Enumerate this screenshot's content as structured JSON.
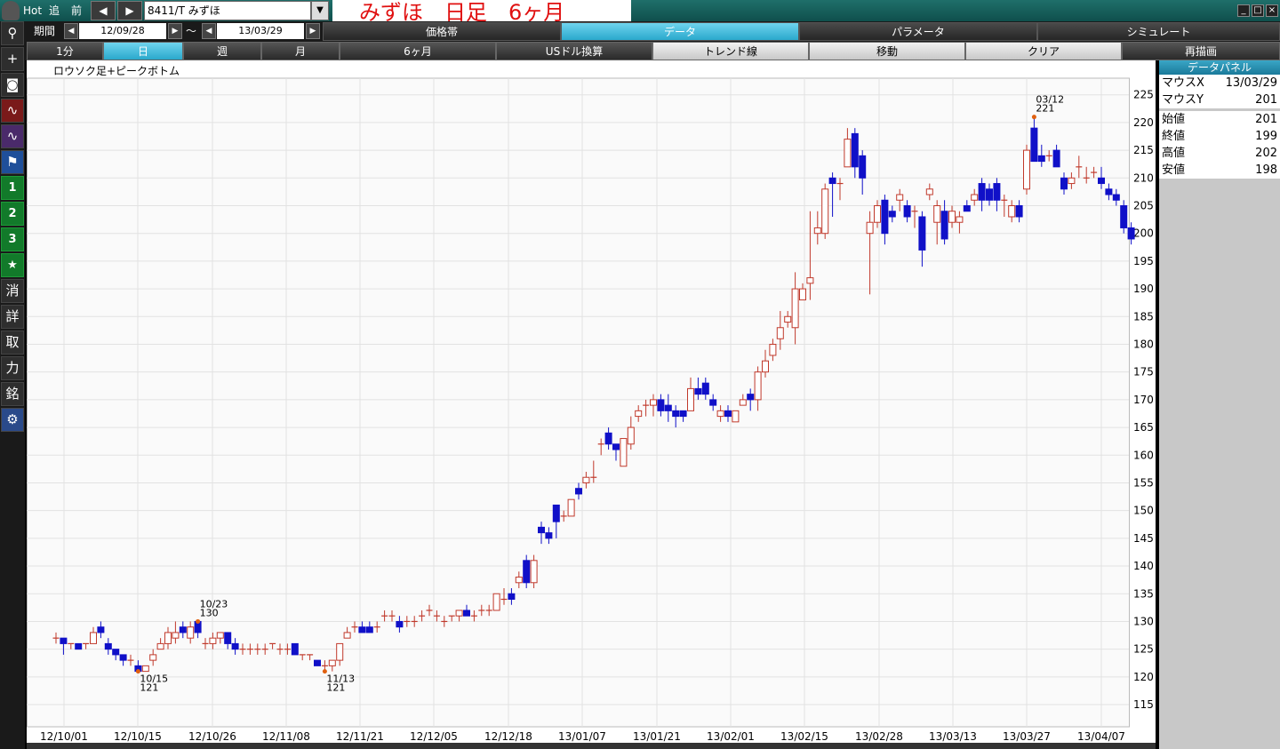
{
  "title_bar": {
    "hot": "Hot",
    "add": "追",
    "prev": "前",
    "arrow_left": "◀",
    "arrow_right": "▶",
    "symbol": "8411/T みずほ",
    "dropdown": "▼",
    "chart_title": "みずほ　日足　6ヶ月",
    "win_minimize": "_",
    "win_maximize": "□",
    "win_close": "×"
  },
  "period": {
    "label": "期間",
    "from": "12/09/28",
    "tilde": "～",
    "to": "13/03/29"
  },
  "top_tabs": [
    {
      "label": "価格帯",
      "active": false
    },
    {
      "label": "データ",
      "active": true
    },
    {
      "label": "パラメータ",
      "active": false
    },
    {
      "label": "シミュレート",
      "active": false
    }
  ],
  "row3_tabs": [
    {
      "label": "1分",
      "style": "normal"
    },
    {
      "label": "日",
      "style": "active"
    },
    {
      "label": "週",
      "style": "normal"
    },
    {
      "label": "月",
      "style": "normal"
    },
    {
      "label": "6ヶ月",
      "style": "normal"
    },
    {
      "label": "USドル換算",
      "style": "normal"
    },
    {
      "label": "トレンド線",
      "style": "light"
    },
    {
      "label": "移動",
      "style": "light"
    },
    {
      "label": "クリア",
      "style": "light"
    },
    {
      "label": "再描画",
      "style": "normal"
    }
  ],
  "left_toolbar": [
    {
      "name": "search-icon",
      "glyph": "⚲",
      "style": ""
    },
    {
      "name": "crosshair-icon",
      "glyph": "+",
      "style": ""
    },
    {
      "name": "camera-icon",
      "glyph": "◙",
      "style": ""
    },
    {
      "name": "chart-red-icon",
      "glyph": "∿",
      "style": "red"
    },
    {
      "name": "chart-purple-icon",
      "glyph": "∿",
      "style": "purple"
    },
    {
      "name": "flag-icon",
      "glyph": "⚑",
      "style": "blue"
    },
    {
      "name": "preset-1-icon",
      "glyph": "1",
      "style": "green"
    },
    {
      "name": "preset-2-icon",
      "glyph": "2",
      "style": "green"
    },
    {
      "name": "preset-3-icon",
      "glyph": "3",
      "style": "green"
    },
    {
      "name": "star-icon",
      "glyph": "★",
      "style": "green"
    },
    {
      "name": "erase-icon",
      "glyph": "消",
      "style": ""
    },
    {
      "name": "detail-icon",
      "glyph": "詳",
      "style": ""
    },
    {
      "name": "take-icon",
      "glyph": "取",
      "style": ""
    },
    {
      "name": "power-icon",
      "glyph": "力",
      "style": ""
    },
    {
      "name": "brand-icon",
      "glyph": "銘",
      "style": ""
    },
    {
      "name": "gear-icon",
      "glyph": "⚙",
      "style": "gear"
    }
  ],
  "data_panel": {
    "title": "データパネル",
    "mouse_x_label": "マウスX",
    "mouse_x": "13/03/29",
    "mouse_y_label": "マウスY",
    "mouse_y": "201",
    "open_label": "始値",
    "open": "201",
    "close_label": "終値",
    "close": "199",
    "high_label": "高値",
    "high": "202",
    "low_label": "安値",
    "low": "198"
  },
  "chart_data": {
    "type": "candlestick",
    "title": "ロウソク足+ピークボトム",
    "ylim": [
      111,
      228
    ],
    "yticks": [
      115,
      120,
      125,
      130,
      135,
      140,
      145,
      150,
      155,
      160,
      165,
      170,
      175,
      180,
      185,
      190,
      195,
      200,
      205,
      210,
      215,
      220,
      225
    ],
    "xticks": [
      "12/10/01",
      "12/10/15",
      "12/10/26",
      "12/11/08",
      "12/11/21",
      "12/12/05",
      "12/12/18",
      "13/01/07",
      "13/01/21",
      "13/02/01",
      "13/02/15",
      "13/02/28",
      "13/03/13",
      "13/03/27",
      "13/04/07"
    ],
    "up_color": "#c0392b",
    "down_color": "#1010c8",
    "candles": [
      [
        127,
        128,
        126,
        127
      ],
      [
        127,
        127,
        124,
        126
      ],
      [
        126,
        126,
        125,
        126
      ],
      [
        126,
        126,
        125,
        125
      ],
      [
        126,
        126,
        125,
        126
      ],
      [
        126,
        129,
        126,
        128
      ],
      [
        129,
        130,
        127,
        128
      ],
      [
        126,
        127,
        124,
        125
      ],
      [
        125,
        125,
        123,
        124
      ],
      [
        124,
        124,
        122,
        123
      ],
      [
        123,
        124,
        122,
        123
      ],
      [
        122,
        123,
        121,
        121
      ],
      [
        121,
        122,
        121,
        122
      ],
      [
        123,
        125,
        122,
        124
      ],
      [
        125,
        127,
        125,
        126
      ],
      [
        126,
        129,
        125,
        128
      ],
      [
        127,
        130,
        126,
        128
      ],
      [
        129,
        130,
        127,
        128
      ],
      [
        127,
        130,
        126,
        129
      ],
      [
        130,
        130,
        127,
        128
      ],
      [
        126,
        127,
        125,
        126
      ],
      [
        126,
        128,
        125,
        127
      ],
      [
        127,
        128,
        126,
        128
      ],
      [
        128,
        128,
        125,
        126
      ],
      [
        126,
        127,
        124,
        125
      ],
      [
        125,
        126,
        124,
        125
      ],
      [
        125,
        126,
        124,
        125
      ],
      [
        125,
        126,
        124,
        125
      ],
      [
        125,
        126,
        124,
        125
      ],
      [
        126,
        126,
        125,
        126
      ],
      [
        125,
        126,
        124,
        125
      ],
      [
        125,
        126,
        124,
        125
      ],
      [
        126,
        126,
        124,
        124
      ],
      [
        124,
        124,
        123,
        124
      ],
      [
        124,
        124,
        123,
        124
      ],
      [
        123,
        123,
        122,
        122
      ],
      [
        122,
        123,
        121,
        122
      ],
      [
        122,
        123,
        121,
        123
      ],
      [
        123,
        126,
        122,
        126
      ],
      [
        127,
        129,
        127,
        128
      ],
      [
        129,
        130,
        128,
        129
      ],
      [
        129,
        130,
        128,
        128
      ],
      [
        129,
        130,
        128,
        128
      ],
      [
        129,
        130,
        128,
        129
      ],
      [
        131,
        132,
        130,
        131
      ],
      [
        131,
        132,
        130,
        131
      ],
      [
        130,
        131,
        128,
        129
      ],
      [
        130,
        131,
        129,
        130
      ],
      [
        130,
        131,
        129,
        130
      ],
      [
        131,
        132,
        130,
        131
      ],
      [
        132,
        133,
        131,
        132
      ],
      [
        131,
        132,
        130,
        131
      ],
      [
        130,
        131,
        129,
        130
      ],
      [
        131,
        131,
        130,
        131
      ],
      [
        131,
        132,
        130,
        132
      ],
      [
        132,
        133,
        131,
        131
      ],
      [
        131,
        132,
        130,
        131
      ],
      [
        132,
        133,
        131,
        132
      ],
      [
        132,
        133,
        131,
        132
      ],
      [
        132,
        135,
        132,
        135
      ],
      [
        134,
        136,
        133,
        134
      ],
      [
        135,
        136,
        133,
        134
      ],
      [
        137,
        139,
        136,
        138
      ],
      [
        141,
        142,
        136,
        137
      ],
      [
        137,
        142,
        136,
        141
      ],
      [
        147,
        148,
        144,
        146
      ],
      [
        146,
        147,
        144,
        145
      ],
      [
        151,
        151,
        145,
        148
      ],
      [
        149,
        150,
        148,
        149
      ],
      [
        149,
        152,
        149,
        152
      ],
      [
        154,
        155,
        152,
        153
      ],
      [
        155,
        157,
        154,
        156
      ],
      [
        156,
        159,
        155,
        156
      ],
      [
        162,
        163,
        160,
        162
      ],
      [
        164,
        165,
        161,
        162
      ],
      [
        162,
        162,
        159,
        161
      ],
      [
        158,
        162,
        158,
        163
      ],
      [
        162,
        167,
        161,
        165
      ],
      [
        167,
        169,
        166,
        168
      ],
      [
        169,
        170,
        167,
        169
      ],
      [
        169,
        171,
        167,
        170
      ],
      [
        170,
        171,
        167,
        168
      ],
      [
        169,
        171,
        166,
        168
      ],
      [
        168,
        169,
        165,
        167
      ],
      [
        168,
        168,
        166,
        167
      ],
      [
        168,
        174,
        168,
        172
      ],
      [
        172,
        174,
        170,
        171
      ],
      [
        173,
        174,
        170,
        171
      ],
      [
        170,
        171,
        168,
        169
      ],
      [
        167,
        169,
        166,
        168
      ],
      [
        168,
        169,
        166,
        167
      ],
      [
        166,
        168,
        166,
        168
      ],
      [
        169,
        171,
        169,
        170
      ],
      [
        171,
        172,
        168,
        170
      ],
      [
        170,
        176,
        168,
        175
      ],
      [
        175,
        179,
        174,
        177
      ],
      [
        178,
        181,
        177,
        180
      ],
      [
        181,
        186,
        179,
        183
      ],
      [
        184,
        186,
        183,
        185
      ],
      [
        183,
        193,
        180,
        190
      ],
      [
        188,
        191,
        188,
        190
      ],
      [
        191,
        204,
        188,
        192
      ],
      [
        200,
        204,
        198,
        201
      ],
      [
        200,
        209,
        199,
        208
      ],
      [
        210,
        211,
        203,
        209
      ],
      [
        209,
        210,
        206,
        209
      ],
      [
        212,
        219,
        212,
        217
      ],
      [
        218,
        219,
        210,
        212
      ],
      [
        214,
        215,
        207,
        210
      ],
      [
        200,
        204,
        189,
        202
      ],
      [
        202,
        206,
        201,
        205
      ],
      [
        206,
        207,
        198,
        200
      ],
      [
        204,
        205,
        202,
        203
      ],
      [
        206,
        208,
        204,
        207
      ],
      [
        205,
        206,
        202,
        203
      ],
      [
        204,
        205,
        201,
        204
      ],
      [
        203,
        204,
        194,
        197
      ],
      [
        207,
        209,
        206,
        208
      ],
      [
        202,
        206,
        198,
        205
      ],
      [
        204,
        206,
        198,
        199
      ],
      [
        202,
        205,
        201,
        204
      ],
      [
        202,
        204,
        200,
        203
      ],
      [
        205,
        206,
        204,
        204
      ],
      [
        206,
        208,
        205,
        207
      ],
      [
        209,
        210,
        204,
        206
      ],
      [
        208,
        209,
        205,
        206
      ],
      [
        209,
        210,
        204,
        206
      ],
      [
        206,
        207,
        203,
        206
      ],
      [
        203,
        206,
        202,
        205
      ],
      [
        205,
        206,
        202,
        203
      ],
      [
        208,
        216,
        207,
        215
      ],
      [
        219,
        221,
        213,
        213
      ],
      [
        214,
        216,
        212,
        213
      ],
      [
        214,
        215,
        213,
        214
      ],
      [
        215,
        216,
        212,
        212
      ],
      [
        210,
        211,
        207,
        208
      ],
      [
        209,
        211,
        208,
        210
      ],
      [
        212,
        214,
        210,
        212
      ],
      [
        210,
        212,
        209,
        210
      ],
      [
        211,
        212,
        210,
        211
      ],
      [
        210,
        212,
        208,
        209
      ],
      [
        208,
        209,
        206,
        207
      ],
      [
        207,
        208,
        205,
        206
      ],
      [
        205,
        206,
        200,
        201
      ],
      [
        201,
        202,
        198,
        199
      ]
    ],
    "peaks": [
      {
        "index": 11,
        "date": "10/15",
        "value": "121",
        "type": "bottom"
      },
      {
        "index": 19,
        "date": "10/23",
        "value": "130",
        "type": "peak"
      },
      {
        "index": 36,
        "date": "11/13",
        "value": "121",
        "type": "bottom"
      },
      {
        "index": 131,
        "date": "03/12",
        "value": "221",
        "type": "peak"
      }
    ]
  }
}
